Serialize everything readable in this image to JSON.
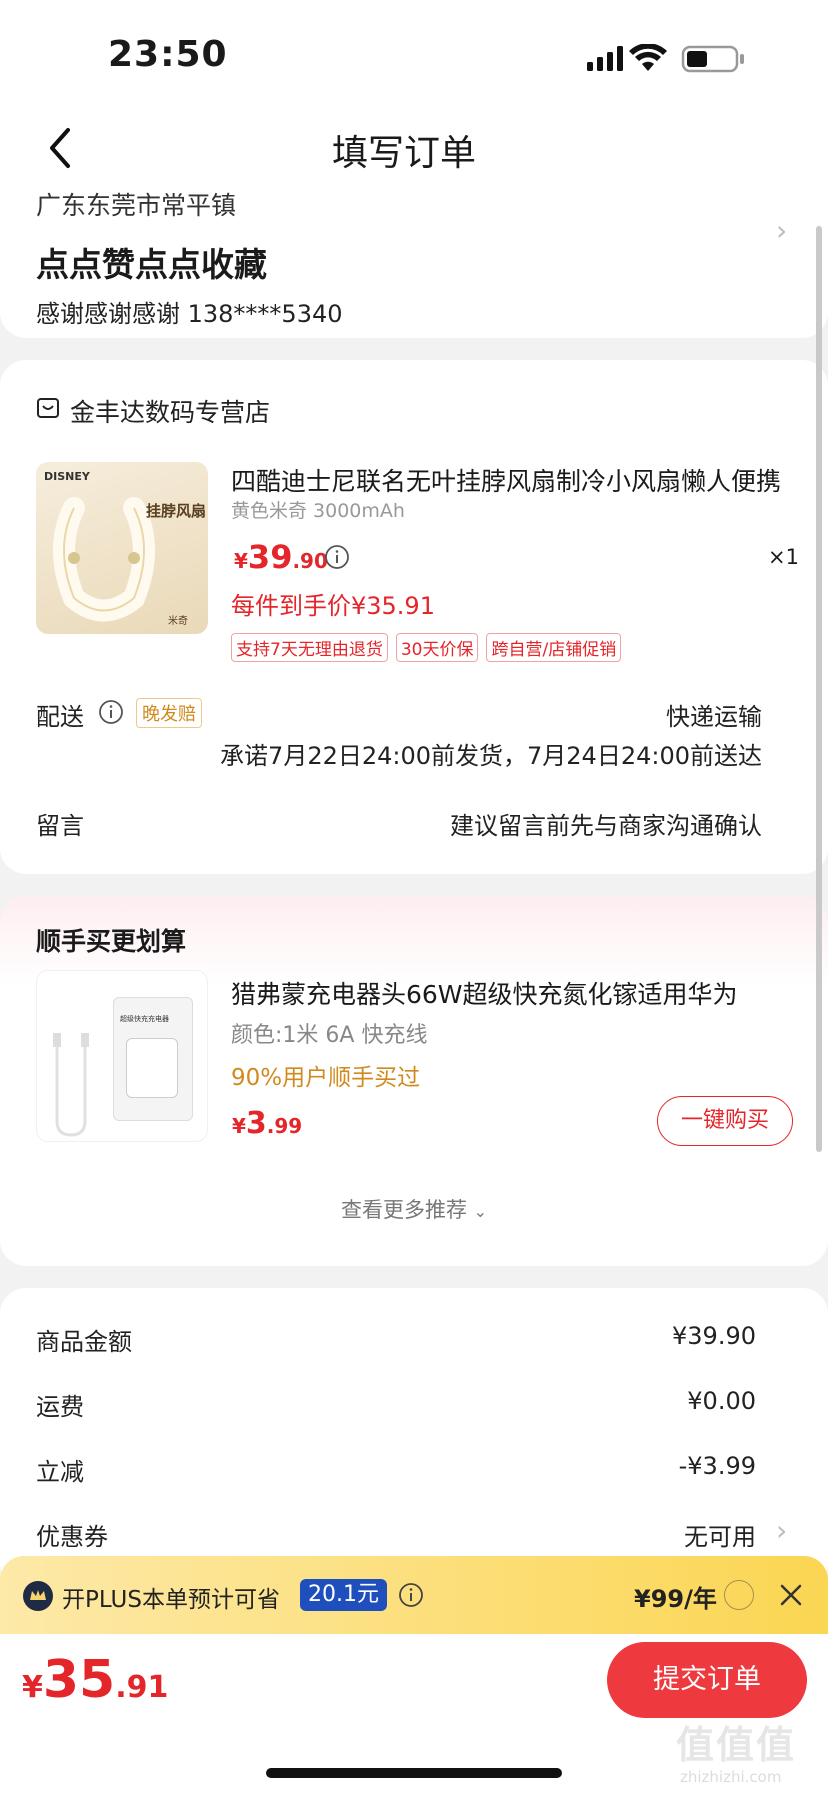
{
  "status": {
    "time": "23:50"
  },
  "header": {
    "title": "填写订单"
  },
  "address": {
    "region": "广东东莞市常平镇",
    "detail": "点点赞点点收藏",
    "contact": "感谢感谢感谢  138****5340"
  },
  "store": {
    "name": "金丰达数码专营店",
    "product": {
      "title": "四酷迪士尼联名无叶挂脖风扇制冷小风扇懒人便携",
      "spec": "黄色米奇 3000mAh",
      "price_symbol": "¥",
      "price_int": "39",
      "price_dec": ".90",
      "qty": "×1",
      "unit_price": "每件到手价¥35.91",
      "tags": [
        "支持7天无理由退货",
        "30天价保",
        "跨自营/店铺促销"
      ],
      "image_text": "挂脖风扇",
      "image_brand": "DISNEY",
      "image_sub": "米奇"
    },
    "delivery": {
      "label": "配送",
      "badge": "晚发赔",
      "method": "快递运输",
      "promise": "承诺7月22日24:00前发货，7月24日24:00前送达"
    },
    "message": {
      "label": "留言",
      "placeholder": "建议留言前先与商家沟通确认"
    }
  },
  "addon": {
    "title": "顺手买更划算",
    "product": {
      "title": "猎弗蒙充电器头66W超级快充氮化镓适用华为",
      "spec": "颜色:1米 6A 快充线",
      "social": "90%用户顺手买过",
      "price_symbol": "¥",
      "price_int": "3",
      "price_dec": ".99",
      "button": "一键购买",
      "box_text": "超级快充充电器"
    },
    "more": "查看更多推荐"
  },
  "summary": {
    "rows": [
      {
        "label": "商品金额",
        "value": "¥39.90"
      },
      {
        "label": "运费",
        "value": "¥0.00"
      },
      {
        "label": "立减",
        "value": "-¥3.99"
      },
      {
        "label": "优惠券",
        "value": "无可用"
      }
    ]
  },
  "plus": {
    "text": "开PLUS本单预计可省",
    "saving": "20.1元",
    "price": "¥99/年"
  },
  "footer": {
    "price_symbol": "¥",
    "price_int": "35",
    "price_dec": ".91",
    "submit": "提交订单",
    "watermark": "值值值",
    "watermark_url": "zhizhizhi.com"
  },
  "colors": {
    "accent": "#e4252a",
    "orange": "#d08a1e",
    "plus_bg": "#fbd653",
    "plus_badge": "#1e4fbd"
  }
}
